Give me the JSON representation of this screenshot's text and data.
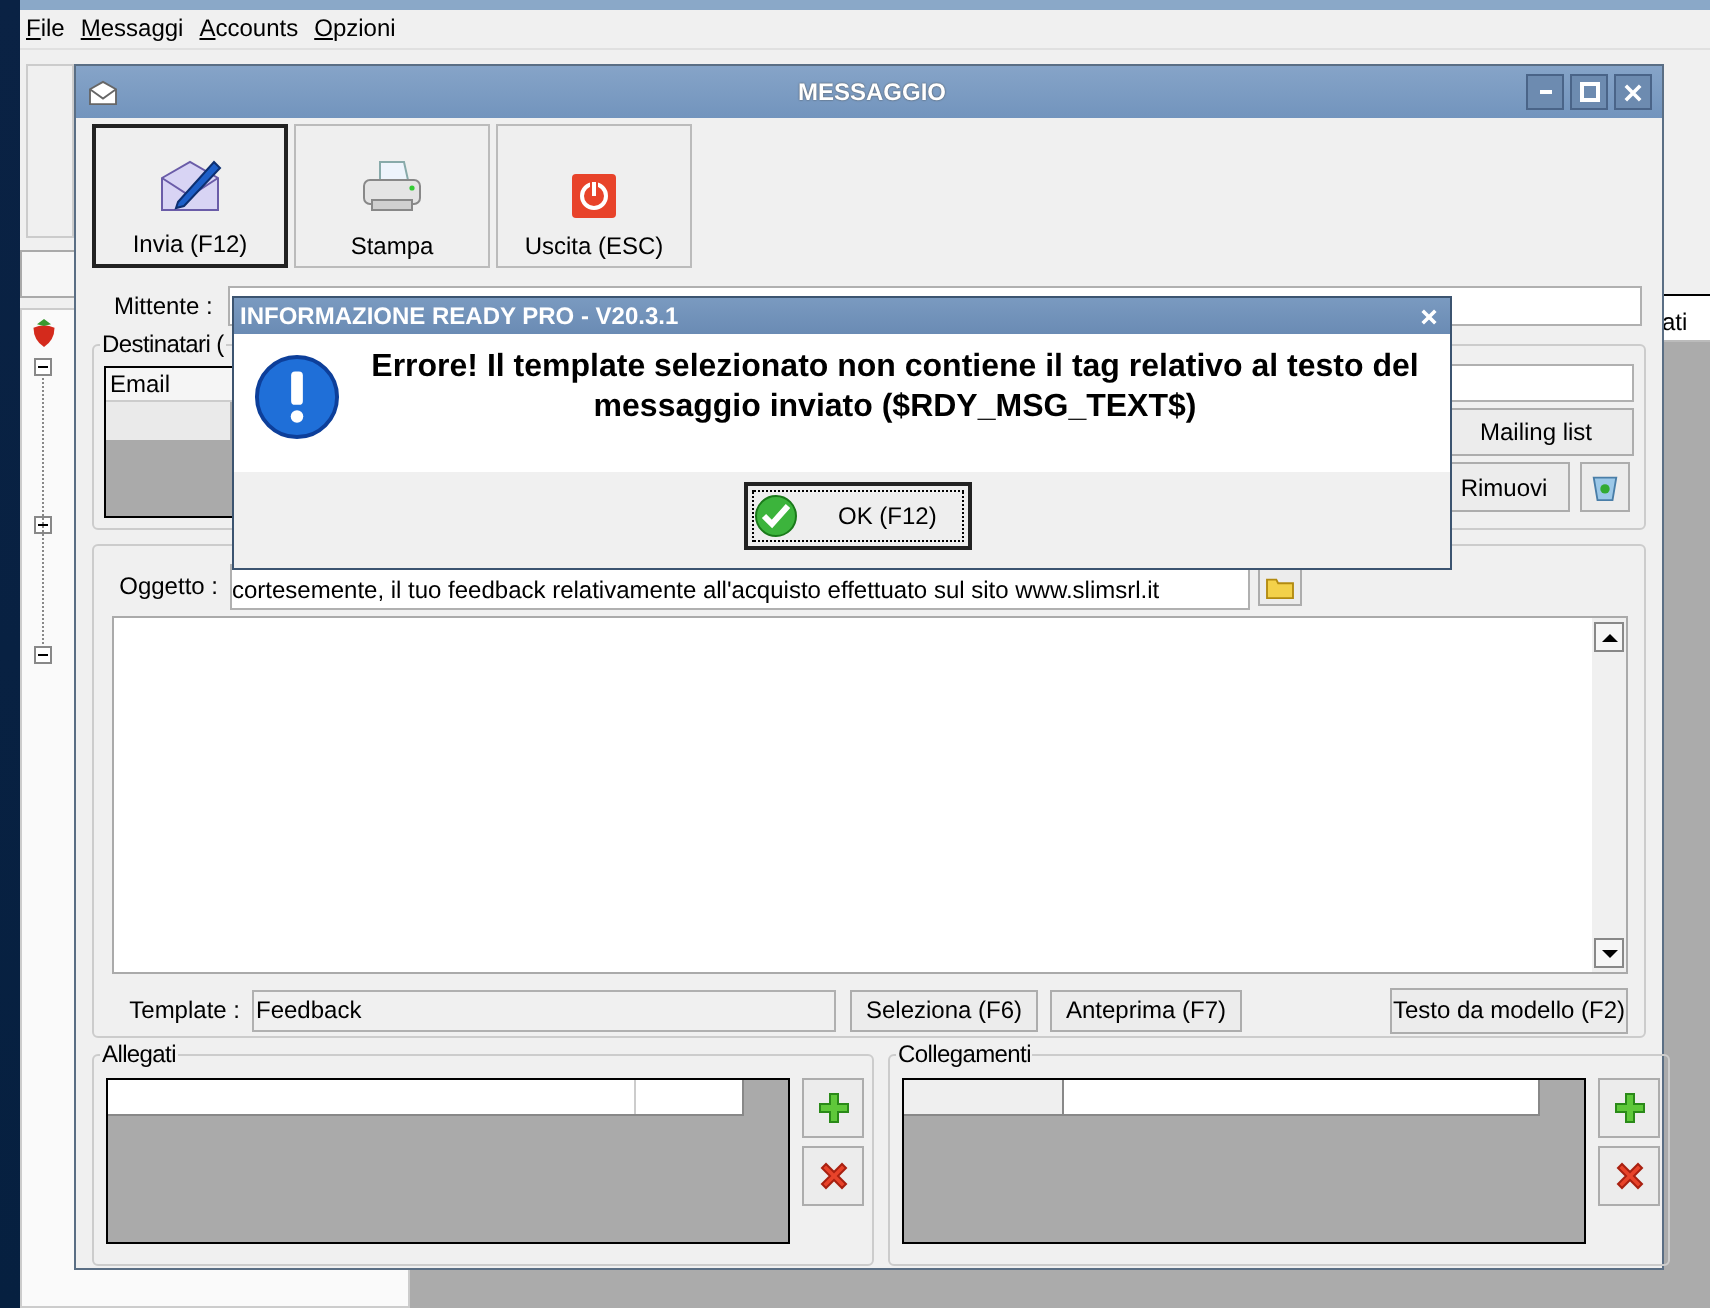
{
  "app": {
    "menu": [
      {
        "label": "File"
      },
      {
        "label": "Messaggi"
      },
      {
        "label": "Accounts"
      },
      {
        "label": "Opzioni"
      }
    ],
    "column_header": "ati"
  },
  "window": {
    "title": "MESSAGGIO",
    "toolbar": [
      {
        "label": "Invia (F12)",
        "kind": "send",
        "selected": true
      },
      {
        "label": "Stampa",
        "kind": "print",
        "selected": false
      },
      {
        "label": "Uscita (ESC)",
        "kind": "exit",
        "selected": false
      }
    ],
    "sender_label": "Mittente :",
    "recipients": {
      "title": "Destinatari (",
      "column": "Email",
      "mailing_list_button": "Mailing list",
      "remove_button": "Rimuovi"
    },
    "subject_label": "Oggetto :",
    "subject": "cortesemente, il tuo feedback relativamente all'acquisto effettuato sul sito www.slimsrl.it",
    "template_label": "Template :",
    "template": "Feedback",
    "buttons": [
      "Seleziona (F6)",
      "Anteprima (F7)",
      "Testo da modello (F2)"
    ],
    "attachments": {
      "title": "Allegati"
    },
    "links": {
      "title": "Collegamenti"
    }
  },
  "dialog": {
    "title": "INFORMAZIONE READY PRO - V20.3.1",
    "message": "Errore! Il template selezionato non contiene il tag relativo al testo del messaggio inviato ($RDY_MSG_TEXT$)",
    "ok_button": "OK (F12)"
  }
}
